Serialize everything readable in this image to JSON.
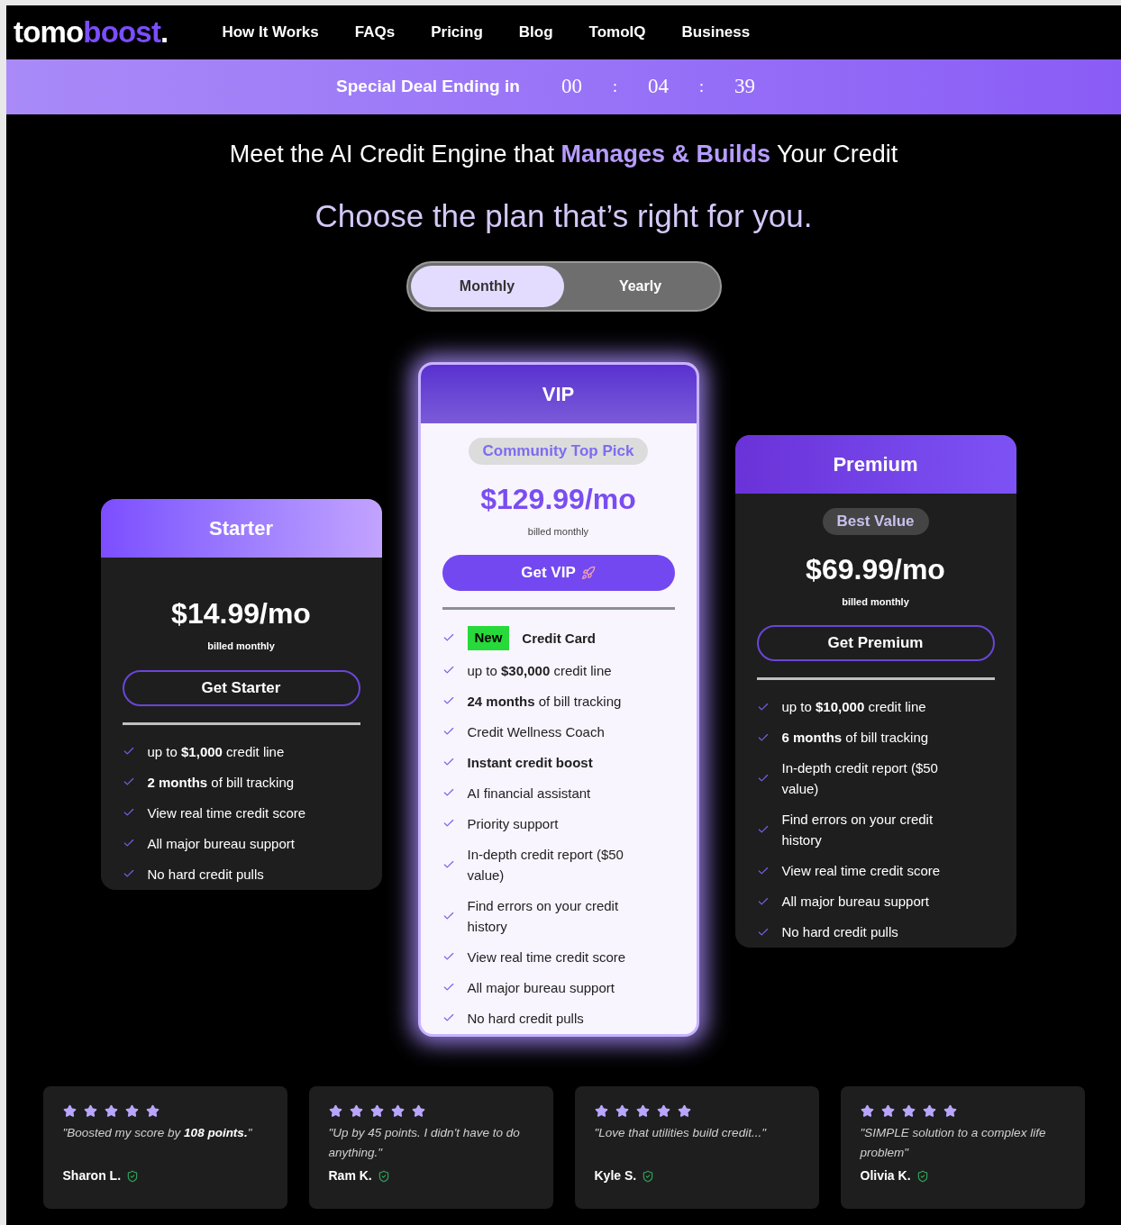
{
  "nav": {
    "logo": {
      "main": "tomo",
      "accent": "boost",
      "dot": "."
    },
    "links": [
      "How It Works",
      "FAQs",
      "Pricing",
      "Blog",
      "TomoIQ",
      "Business"
    ]
  },
  "deal_bar": {
    "label": "Special Deal Ending in",
    "countdown": [
      "00",
      "04",
      "39"
    ],
    "separators": [
      ":",
      ":"
    ]
  },
  "headline": "Meet the AI Credit Engine that **Manages & Builds** Your Credit",
  "subheadline": "Choose the plan that’s right for you.",
  "billing_toggle": [
    {
      "label": "Monthly",
      "selected": true
    },
    {
      "label": "Yearly",
      "selected": false
    }
  ],
  "plans": [
    {
      "name": "Starter",
      "highlighted": false,
      "price": "$14.99/mo",
      "billing": "billed monthly",
      "button": "Get Starter",
      "button_icon": false,
      "features": [
        {
          "text": "up to **$1,000** credit line"
        },
        {
          "text": "**2 months** of bill tracking"
        },
        {
          "text": "View real time credit score"
        },
        {
          "text": "All major bureau support"
        },
        {
          "text": "No hard credit pulls"
        }
      ]
    },
    {
      "name": "VIP",
      "highlighted": true,
      "badge": "Community Top Pick",
      "price": "$129.99/mo",
      "billing": "billed monthly",
      "button": "Get VIP",
      "button_icon": true,
      "features": [
        {
          "tag": "New",
          "text": "Credit Card",
          "emphasis": true
        },
        {
          "text": "up to **$30,000** credit line"
        },
        {
          "text": "**24 months** of bill tracking"
        },
        {
          "text": "Credit Wellness Coach"
        },
        {
          "text": "Instant credit boost",
          "emphasis": true
        },
        {
          "text": "AI financial assistant"
        },
        {
          "text": "Priority support"
        },
        {
          "text": "In-depth credit report ($50 value)"
        },
        {
          "text": "Find errors on your credit history"
        },
        {
          "text": "View real time credit score"
        },
        {
          "text": "All major bureau support"
        },
        {
          "text": "No hard credit pulls"
        }
      ]
    },
    {
      "name": "Premium",
      "highlighted": false,
      "badge": "Best Value",
      "price": "$69.99/mo",
      "billing": "billed monthly",
      "button": "Get Premium",
      "button_icon": false,
      "features": [
        {
          "text": "up to **$10,000** credit line"
        },
        {
          "text": "**6 months** of bill tracking"
        },
        {
          "text": "In-depth credit report ($50 value)"
        },
        {
          "text": "Find errors on your credit history"
        },
        {
          "text": "View real time credit score"
        },
        {
          "text": "All major bureau support"
        },
        {
          "text": "No hard credit pulls"
        }
      ]
    }
  ],
  "reviews": [
    {
      "stars": 5,
      "quote": "\"Boosted my score by **108 points.**\"",
      "author": "Sharon L.",
      "verified": true
    },
    {
      "stars": 5,
      "quote": "\"Up by 45 points. I didn't have to do anything.\"",
      "author": "Ram K.",
      "verified": true
    },
    {
      "stars": 5,
      "quote": "\"Love that utilities build credit...\"",
      "author": "Kyle S.",
      "verified": true
    },
    {
      "stars": 5,
      "quote": "\"SIMPLE solution to a complex life problem\"",
      "author": "Olivia K.",
      "verified": true
    }
  ]
}
